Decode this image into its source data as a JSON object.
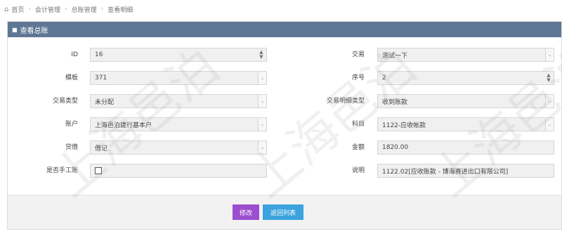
{
  "breadcrumb": {
    "items": [
      "首页",
      "会计管理",
      "总账管理",
      "查看明细"
    ]
  },
  "panel": {
    "title": "查看总账"
  },
  "form": {
    "id_label": "ID",
    "id_value": "16",
    "template_label": "模板",
    "template_value": "371",
    "trade_type_label": "交易类型",
    "trade_type_value": "未分配",
    "account_label": "账户",
    "account_value": "上海邑泊建行基本户",
    "debit_credit_label": "贷借",
    "debit_credit_value": "借记",
    "manual_label": "是否手工账",
    "trade_label": "交易",
    "trade_value": "测试一下",
    "seq_label": "序号",
    "seq_value": "2",
    "detail_type_label": "交易明细类型",
    "detail_type_value": "收到账款",
    "subject_label": "科目",
    "subject_value": "1122-应收帐款",
    "amount_label": "金额",
    "amount_value": "1820.00",
    "note_label": "说明",
    "note_value": "1122.02[应收账款 - 博海赛进出口有限公司]"
  },
  "buttons": {
    "edit": "修改",
    "back": "返回列表"
  },
  "watermark": "上海邑泊",
  "colors": {
    "header": "#5f7795",
    "edit_button": "#9b4fd0",
    "back_button": "#3ba3dd"
  }
}
